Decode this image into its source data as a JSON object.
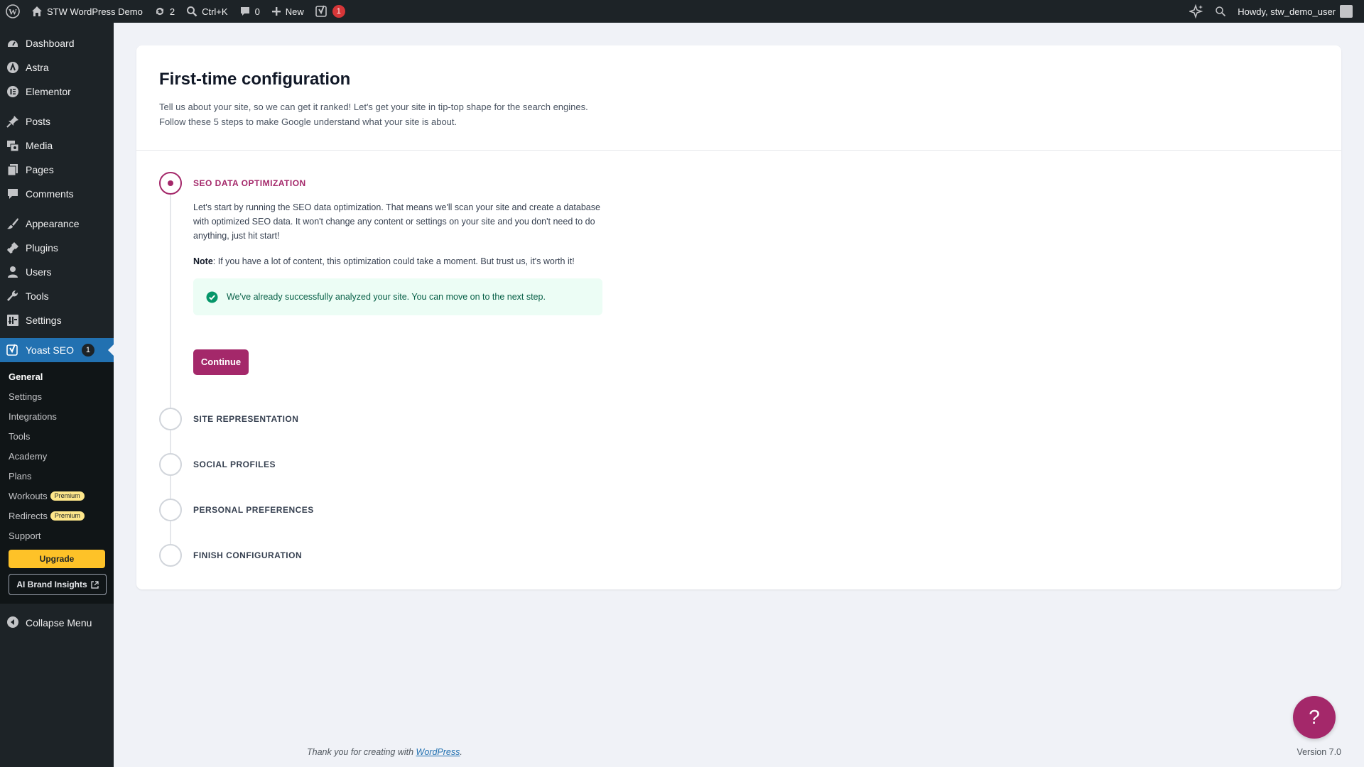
{
  "adminbar": {
    "site_name": "STW WordPress Demo",
    "updates_count": "2",
    "search_shortcut": "Ctrl+K",
    "comments_count": "0",
    "new_label": "New",
    "yoast_badge": "1",
    "greeting": "Howdy, stw_demo_user"
  },
  "sidebar": {
    "items": [
      {
        "label": "Dashboard",
        "icon": "dashboard-icon"
      },
      {
        "label": "Astra",
        "icon": "astra-icon"
      },
      {
        "label": "Elementor",
        "icon": "elementor-icon"
      },
      {
        "label": "Posts",
        "icon": "pin-icon"
      },
      {
        "label": "Media",
        "icon": "media-icon"
      },
      {
        "label": "Pages",
        "icon": "pages-icon"
      },
      {
        "label": "Comments",
        "icon": "comment-icon"
      },
      {
        "label": "Appearance",
        "icon": "brush-icon"
      },
      {
        "label": "Plugins",
        "icon": "plugin-icon"
      },
      {
        "label": "Users",
        "icon": "user-icon"
      },
      {
        "label": "Tools",
        "icon": "wrench-icon"
      },
      {
        "label": "Settings",
        "icon": "settings-icon"
      }
    ],
    "yoast": {
      "label": "Yoast SEO",
      "badge": "1"
    },
    "submenu": [
      {
        "label": "General"
      },
      {
        "label": "Settings"
      },
      {
        "label": "Integrations"
      },
      {
        "label": "Tools"
      },
      {
        "label": "Academy"
      },
      {
        "label": "Plans"
      },
      {
        "label": "Workouts",
        "badge": "Premium"
      },
      {
        "label": "Redirects",
        "badge": "Premium"
      },
      {
        "label": "Support"
      }
    ],
    "upgrade_label": "Upgrade",
    "brand_label": "AI Brand Insights",
    "collapse_label": "Collapse Menu"
  },
  "main": {
    "title": "First-time configuration",
    "description": "Tell us about your site, so we can get it ranked! Let's get your site in tip-top shape for the search engines. Follow these 5 steps to make Google understand what your site is about.",
    "steps": [
      {
        "title": "SEO data optimization"
      },
      {
        "title": "Site representation"
      },
      {
        "title": "Social profiles"
      },
      {
        "title": "Personal preferences"
      },
      {
        "title": "Finish configuration"
      }
    ],
    "step1_body": "Let's start by running the SEO data optimization. That means we'll scan your site and create a database with optimized SEO data. It won't change any content or settings on your site and you don't need to do anything, just hit start!",
    "note_label": "Note",
    "note_text": ": If you have a lot of content, this optimization could take a moment. But trust us, it's worth it!",
    "success_text": "We've already successfully analyzed your site. You can move on to the next step.",
    "continue_label": "Continue"
  },
  "footer": {
    "thanks_prefix": "Thank you for creating with ",
    "thanks_link": "WordPress",
    "thanks_suffix": ".",
    "version": "Version 7.0"
  },
  "help_label": "?",
  "colors": {
    "accent": "#a4286a",
    "wp_blue": "#2271b1",
    "success_bg": "#ecfdf5"
  }
}
